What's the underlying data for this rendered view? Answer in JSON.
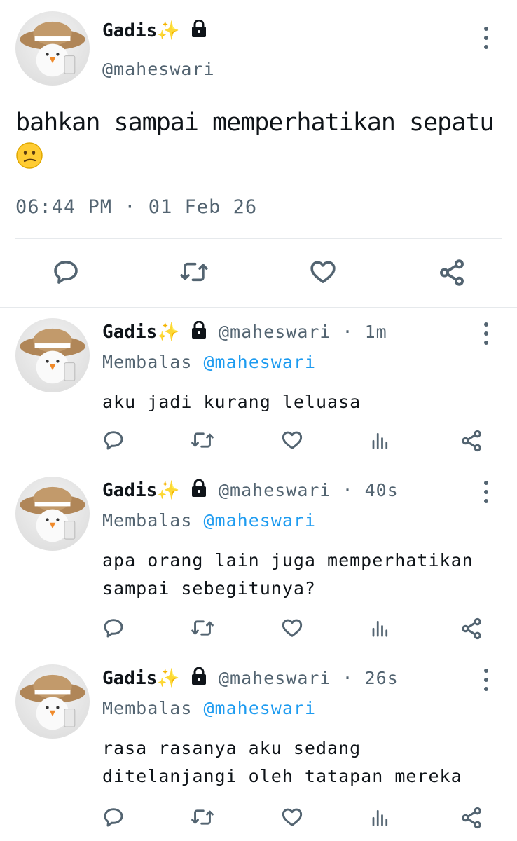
{
  "main": {
    "display_name": "Gadis",
    "sparkle": "✨",
    "handle": "@maheswari",
    "text": "bahkan sampai memperhatikan sepatu",
    "timestamp": "06:44 PM · 01 Feb 26",
    "actions": [
      "reply-icon",
      "retweet-icon",
      "like-icon",
      "share-icon"
    ]
  },
  "replies": [
    {
      "display_name": "Gadis",
      "sparkle": "✨",
      "handle_time": "@maheswari · 1m",
      "replying_prefix": "Membalas",
      "replying_to": "@maheswari",
      "text": "aku jadi kurang leluasa"
    },
    {
      "display_name": "Gadis",
      "sparkle": "✨",
      "handle_time": "@maheswari · 40s",
      "replying_prefix": "Membalas",
      "replying_to": "@maheswari",
      "text": "apa orang lain juga memperhatikan sampai sebegitunya?"
    },
    {
      "display_name": "Gadis",
      "sparkle": "✨",
      "handle_time": "@maheswari · 26s",
      "replying_prefix": "Membalas",
      "replying_to": "@maheswari",
      "text": "rasa rasanya aku sedang ditelanjangi oleh tatapan mereka"
    }
  ],
  "icons": {
    "reply": "reply-icon",
    "retweet": "retweet-icon",
    "like": "like-icon",
    "views": "views-icon",
    "share": "share-icon",
    "lock": "lock-icon",
    "more": "more-icon"
  },
  "colors": {
    "text": "#0f1419",
    "muted": "#536471",
    "link": "#1d9bf0",
    "divider": "#e6e9ec"
  }
}
